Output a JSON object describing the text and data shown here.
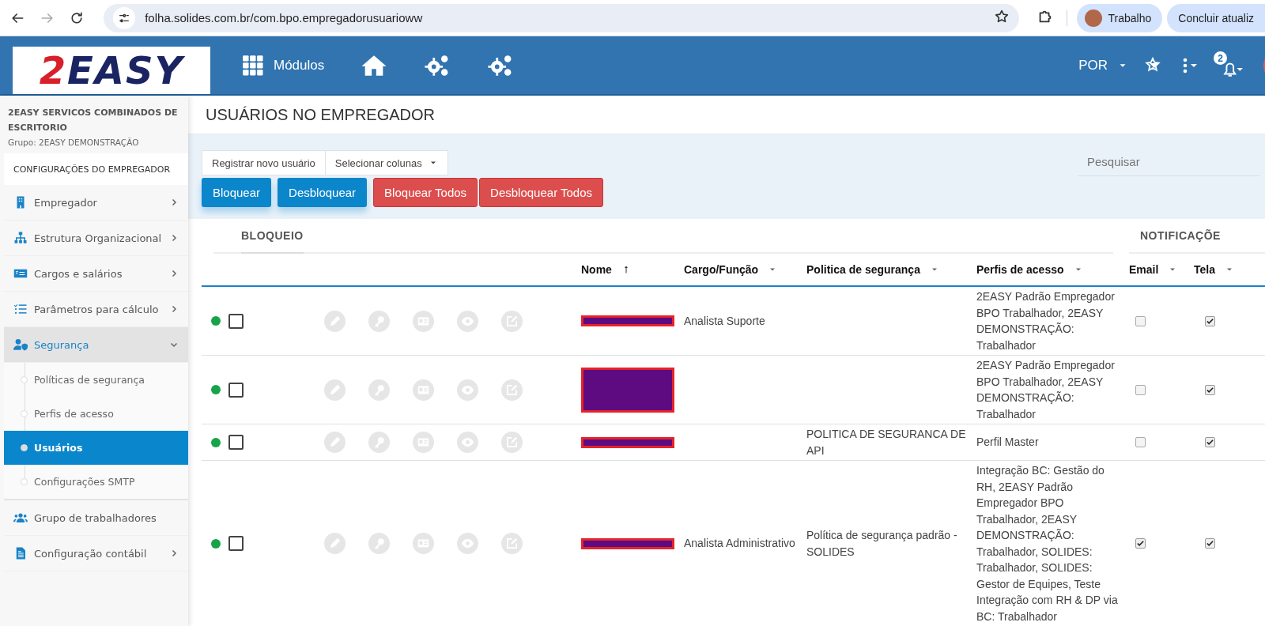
{
  "browser": {
    "url": "folha.solides.com.br/com.bpo.empregadorusuarioww",
    "forward_disabled": true,
    "profile": "Trabalho",
    "update_button": "Concluir atualiz"
  },
  "header": {
    "logo": "2EASY",
    "modules": "Módulos",
    "language": "POR",
    "notifications": "2"
  },
  "sidebar": {
    "company": "2EASY SERVICOS COMBINADOS DE ESCRITORIO",
    "group": "Grupo: 2EASY DEMONSTRAÇÃO",
    "section": "CONFIGURAÇÕES DO EMPREGADOR",
    "items": [
      {
        "label": "Empregador",
        "expanded": false,
        "selected": false
      },
      {
        "label": "Estrutura Organizacional",
        "expanded": false,
        "selected": false
      },
      {
        "label": "Cargos e salários",
        "expanded": false,
        "selected": false
      },
      {
        "label": "Parâmetros para cálculo",
        "expanded": false,
        "selected": false
      },
      {
        "label": "Segurança",
        "expanded": true,
        "selected": false,
        "children": [
          {
            "label": "Políticas de segurança",
            "selected": false
          },
          {
            "label": "Perfis de acesso",
            "selected": false
          },
          {
            "label": "Usuários",
            "selected": true
          },
          {
            "label": "Configurações SMTP",
            "selected": false
          }
        ]
      },
      {
        "label": "Grupo de trabalhadores",
        "selected": false
      },
      {
        "label": "Configuração contábil",
        "expanded": false,
        "selected": false
      }
    ]
  },
  "page_title": "USUÁRIOS NO EMPREGADOR",
  "toolbar": {
    "register": "Registrar novo usuário",
    "columns": "Selecionar colunas",
    "search": {
      "placeholder": "Pesquisar"
    },
    "buttons": [
      {
        "label": "Bloquear",
        "kind": "primary"
      },
      {
        "label": "Desbloquear",
        "kind": "primary"
      },
      {
        "label": "Bloquear Todos",
        "kind": "danger"
      },
      {
        "label": "Desbloquear Todos",
        "kind": "danger"
      }
    ]
  },
  "table": {
    "groups": [
      "BLOQUEIO",
      "NOTIFICAÇÕE"
    ],
    "columns": [
      {
        "label": "Nome",
        "sorted": true
      },
      {
        "label": "Cargo/Função",
        "sorted": false
      },
      {
        "label": "Politica de segurança",
        "sorted": false
      },
      {
        "label": "Perfis de acesso",
        "sorted": false
      },
      {
        "label": "Email",
        "sorted": false
      },
      {
        "label": "Tela",
        "sorted": false
      }
    ],
    "rows": [
      {
        "color": "#17a34a",
        "selected": false,
        "kind": "short",
        "cargo": "Analista Suporte",
        "perfis": "2EASY Padrão Empregador BPO Trabalhador, 2EASY DEMONSTRAÇÃO: Trabalhador",
        "email": false,
        "tela": true
      },
      {
        "color": "#17a34a",
        "selected": false,
        "kind": "tall",
        "perfis": "2EASY Padrão Empregador BPO Trabalhador, 2EASY DEMONSTRAÇÃO: Trabalhador",
        "email": false,
        "tela": true
      },
      {
        "color": "#17a34a",
        "selected": false,
        "kind": "short",
        "politica": "POLITICA DE SEGURANCA DE API",
        "perfis": "Perfil Master",
        "email": false,
        "tela": true
      },
      {
        "color": "#17a34a",
        "selected": false,
        "kind": "short",
        "cargo": "Analista Administrativo",
        "politica": "Política de segurança padrão - SOLIDES",
        "perfis": "Integração BC: Gestão do RH, 2EASY Padrão Empregador BPO Trabalhador, 2EASY DEMONSTRAÇÃO: Trabalhador, SOLIDES: Trabalhador, SOLIDES: Gestor de Equipes, Teste Integração com RH & DP via BC: Trabalhador",
        "email": true,
        "tela": true
      }
    ]
  }
}
